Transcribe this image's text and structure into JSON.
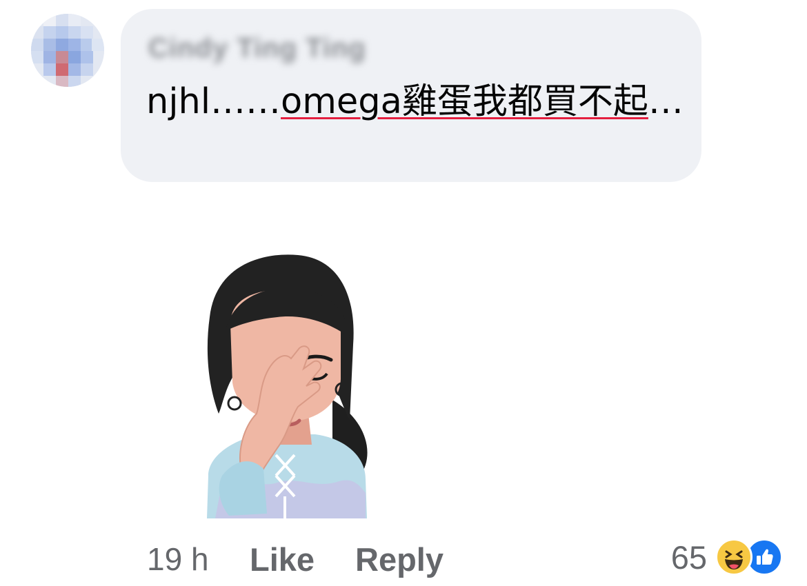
{
  "comment": {
    "author_name": "Cindy Ting Ting",
    "text_part1": "njhl……",
    "text_underlined": "omega雞蛋我都買不起",
    "text_part2": "…",
    "underline_color": "#e41e3f"
  },
  "sticker": {
    "icon": "facepalm-memoji-sticker"
  },
  "footer": {
    "time": "19 h",
    "like_label": "Like",
    "reply_label": "Reply",
    "reaction_count": "65",
    "reaction_icons": [
      "haha-icon",
      "like-icon"
    ]
  },
  "colors": {
    "bubble": "#eff1f5",
    "meta_text": "#65676b",
    "like_blue": "#1877f2",
    "haha_yellow": "#f7c843"
  }
}
